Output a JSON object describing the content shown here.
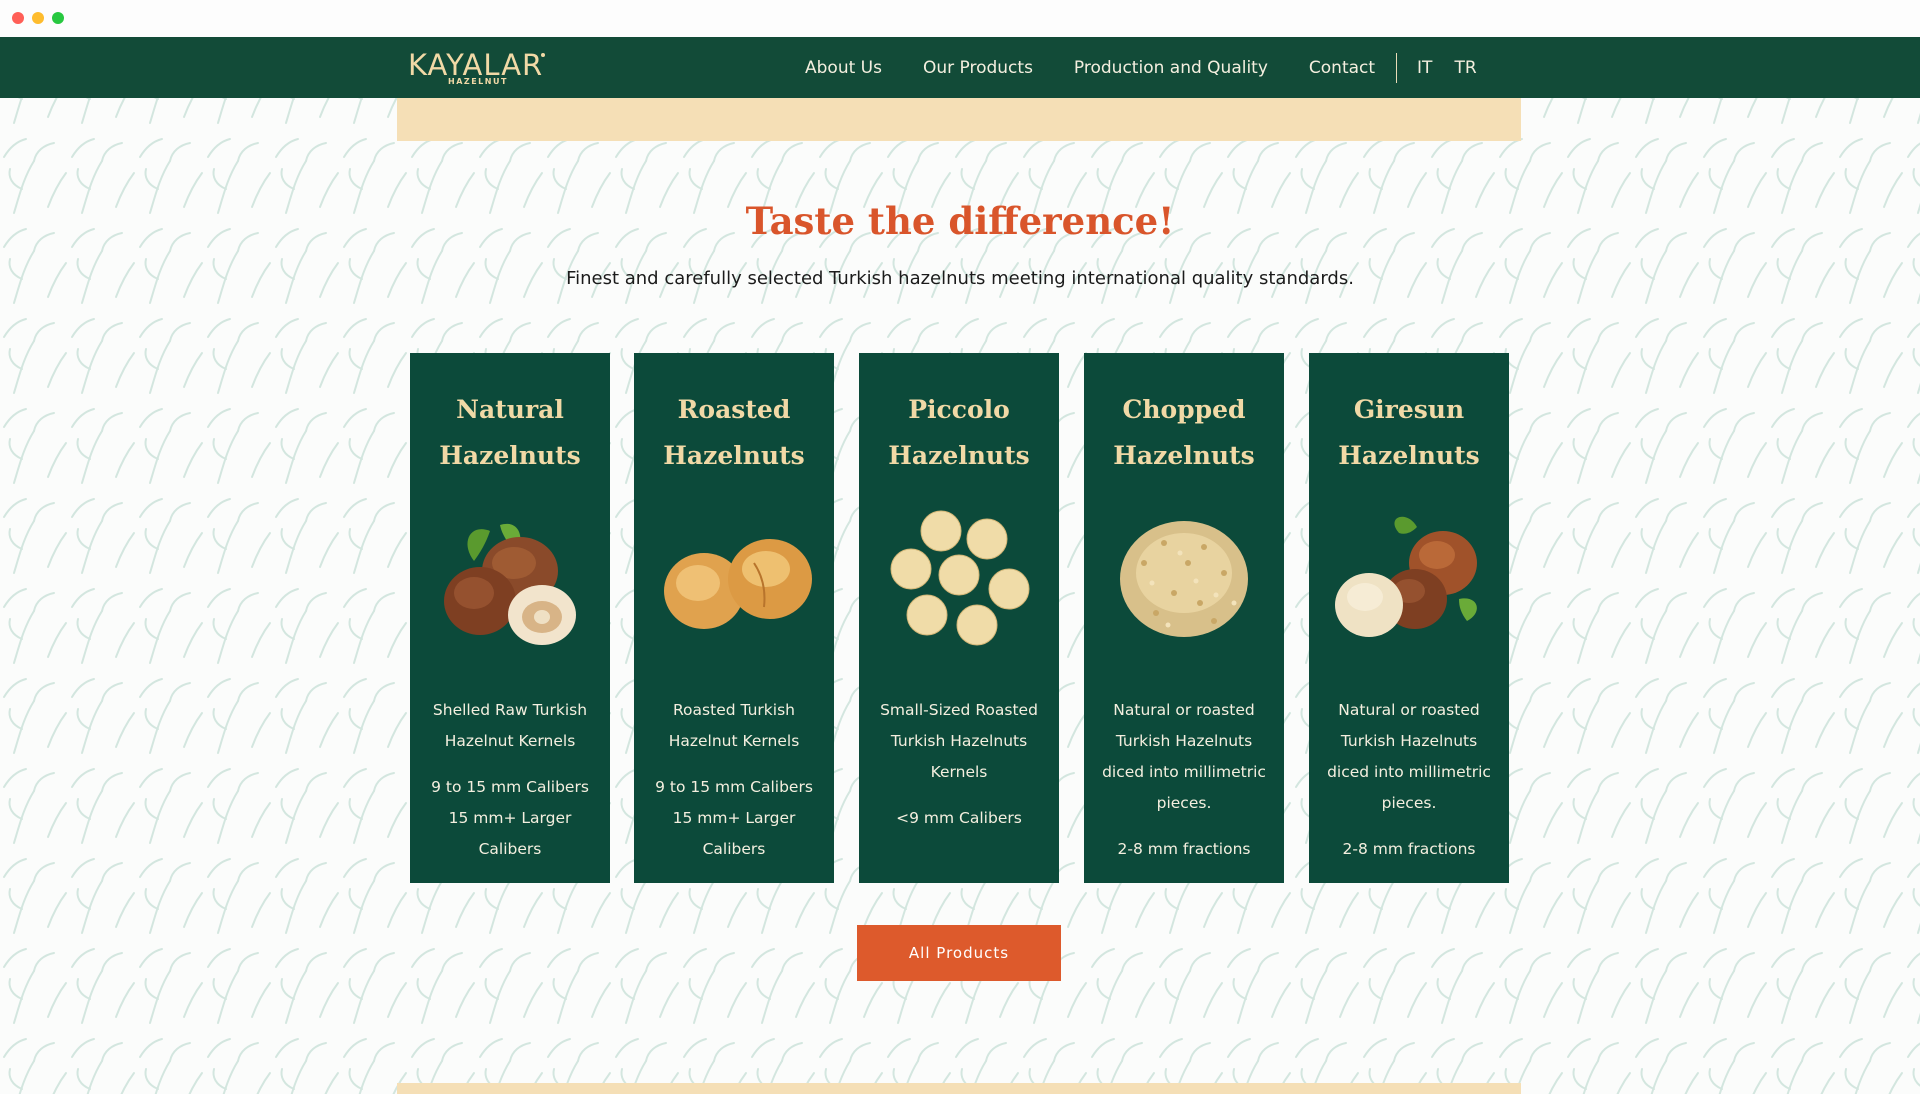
{
  "brand": {
    "name": "KAYALAR",
    "sub": "HAZELNUT"
  },
  "nav": {
    "items": [
      "About Us",
      "Our Products",
      "Production and Quality",
      "Contact"
    ],
    "languages": [
      "IT",
      "TR"
    ]
  },
  "section": {
    "title": "Taste the difference!",
    "subtitle": "Finest and carefully selected Turkish hazelnuts meeting international quality standards."
  },
  "cards": [
    {
      "title_line1": "Natural",
      "title_line2": "Hazelnuts",
      "desc": "Shelled Raw Turkish Hazelnut Kernels",
      "spec": "9 to 15 mm Calibers 15 mm+ Larger Calibers",
      "image": "natural-hazelnuts-image"
    },
    {
      "title_line1": "Roasted",
      "title_line2": "Hazelnuts",
      "desc": "Roasted Turkish Hazelnut Kernels",
      "spec": "9 to 15 mm Calibers 15 mm+ Larger Calibers",
      "image": "roasted-hazelnuts-image"
    },
    {
      "title_line1": "Piccolo",
      "title_line2": "Hazelnuts",
      "desc": "Small-Sized Roasted Turkish Hazelnuts Kernels",
      "spec": "<9 mm Calibers",
      "image": "piccolo-hazelnuts-image"
    },
    {
      "title_line1": "Chopped",
      "title_line2": "Hazelnuts",
      "desc": "Natural or roasted Turkish Hazelnuts diced into millimetric pieces.",
      "spec": "2-8 mm fractions",
      "image": "chopped-hazelnuts-image"
    },
    {
      "title_line1": "Giresun",
      "title_line2": "Hazelnuts",
      "desc": "Natural or roasted Turkish Hazelnuts diced into millimetric pieces.",
      "spec": "2-8 mm fractions",
      "image": "giresun-hazelnuts-image"
    }
  ],
  "cta": {
    "label": "All Products"
  },
  "colors": {
    "nav_bg": "#124b38",
    "card_bg": "#0c4a3a",
    "accent": "#d9552b",
    "gold": "#f1d9a6",
    "band": "#f5dfb6"
  }
}
